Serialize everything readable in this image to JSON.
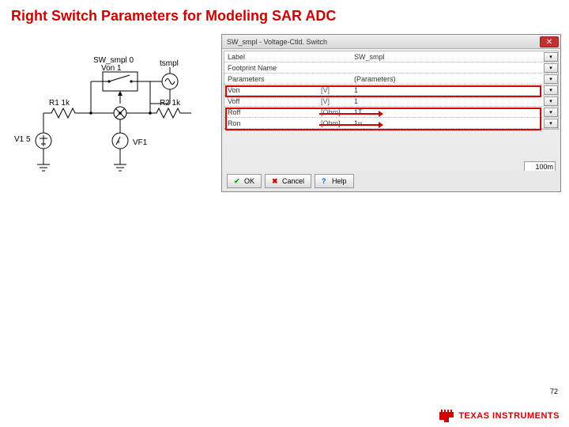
{
  "title": "Right Switch Parameters for Modeling SAR ADC",
  "page_number": "72",
  "schematic": {
    "sw_label": "SW_smpl 0",
    "von_label": "Von 1",
    "tsmpl": "tsmpl",
    "r1": "R1 1k",
    "r2": "R2 1k",
    "v1": "V1 5",
    "vf1": "VF1"
  },
  "dialog": {
    "title": "SW_smpl - Voltage-Ctld. Switch",
    "rows": {
      "label": {
        "name": "Label",
        "value": "SW_smpl"
      },
      "footprint": {
        "name": "Footprint Name",
        "value": ""
      },
      "parameters": {
        "name": "Parameters",
        "value": "(Parameters)"
      },
      "von": {
        "name": "Von",
        "unit": "[V]",
        "value": "1"
      },
      "voff": {
        "name": "Voff",
        "unit": "[V]",
        "value": "1"
      },
      "roff": {
        "name": "Roff",
        "unit": "[Ohm]",
        "value": "1T"
      },
      "ron": {
        "name": "Ron",
        "unit": "[Ohm]",
        "value": "1u"
      }
    },
    "bottom_value": "100m",
    "buttons": {
      "ok": "OK",
      "cancel": "Cancel",
      "help": "Help"
    }
  },
  "brand": "TEXAS INSTRUMENTS"
}
